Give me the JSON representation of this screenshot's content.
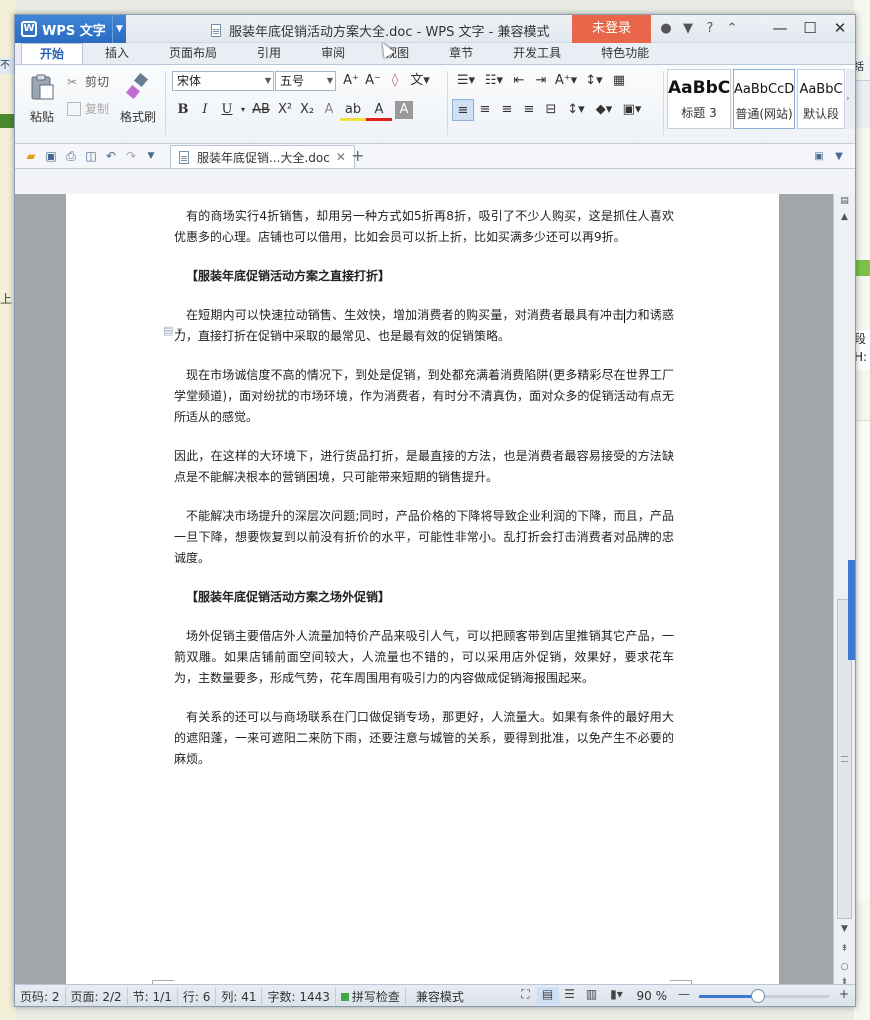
{
  "background": {
    "left_snip": "不妻",
    "right_snip": "括动",
    "right_snip2": "段",
    "right_snip3": "H:"
  },
  "titlebar": {
    "app_name": "WPS 文字",
    "title": "服装年底促销活动方案大全.doc - WPS 文字 - 兼容模式",
    "login": "未登录"
  },
  "tabs": [
    "开始",
    "插入",
    "页面布局",
    "引用",
    "审阅",
    "视图",
    "章节",
    "开发工具",
    "特色功能"
  ],
  "ribbon": {
    "paste": "粘贴",
    "cut": "剪切",
    "copy": "复制",
    "format_painter": "格式刷",
    "font_name": "宋体",
    "font_size": "五号",
    "styles": [
      {
        "sample": "AaBbC",
        "name": "标题 3"
      },
      {
        "sample": "AaBbCcD",
        "name": "普通(网站)"
      },
      {
        "sample": "AaBbC",
        "name": "默认段"
      }
    ]
  },
  "doc_tab": {
    "label": "服装年底促销...大全.doc"
  },
  "document": {
    "p1": "有的商场实行4折销售，却用另一种方式如5折再8折，吸引了不少人购买，这是抓住人喜欢优惠多的心理。店铺也可以借用，比如会员可以折上折，比如买满多少还可以再9折。",
    "h1": "【服装年底促销活动方案之直接打折】",
    "p2a": "在短期内可以快速拉动销售、生效快，增加消费者的购买量，对消费者最具有冲击",
    "p2b": "力和诱惑力，直接打折在促销中采取的最常见、也是最有效的促销策略。",
    "p3": "现在市场诚信度不高的情况下，到处是促销，到处都充满着消费陷阱(更多精彩尽在世界工厂学堂频道)，面对纷扰的市场环境，作为消费者，有时分不清真伪，面对众多的促销活动有点无所适从的感觉。",
    "p4": "因此，在这样的大环境下，进行货品打折，是最直接的方法，也是消费者最容易接受的方法缺点是不能解决根本的营销困境，只可能带来短期的销售提升。",
    "p5": "不能解决市场提升的深层次问题;同时，产品价格的下降将导致企业利润的下降，而且，产品一旦下降，想要恢复到以前没有折价的水平，可能性非常小。乱打折会打击消费者对品牌的忠诚度。",
    "h2": "【服装年底促销活动方案之场外促销】",
    "p6": "场外促销主要借店外人流量加特价产品来吸引人气，可以把顾客带到店里推销其它产品，一箭双雕。如果店铺前面空间较大，人流量也不错的，可以采用店外促销，效果好，要求花车为，主数量要多，形成气势，花车周围用有吸引力的内容做成促销海报围起来。",
    "p7": "有关系的还可以与商场联系在门口做促销专场，那更好，人流量大。如果有条件的最好用大的遮阳蓬，一来可遮阳二来防下雨，还要注意与城管的关系，要得到批准，以免产生不必要的麻烦。"
  },
  "status": {
    "page_code": "页码: 2",
    "pages": "页面: 2/2",
    "section": "节: 1/1",
    "row": "行: 6",
    "col": "列: 41",
    "words": "字数: 1443",
    "spell": "拼写检查",
    "compat": "兼容模式",
    "zoom": "90 %",
    "zoom_fraction": 0.45
  }
}
